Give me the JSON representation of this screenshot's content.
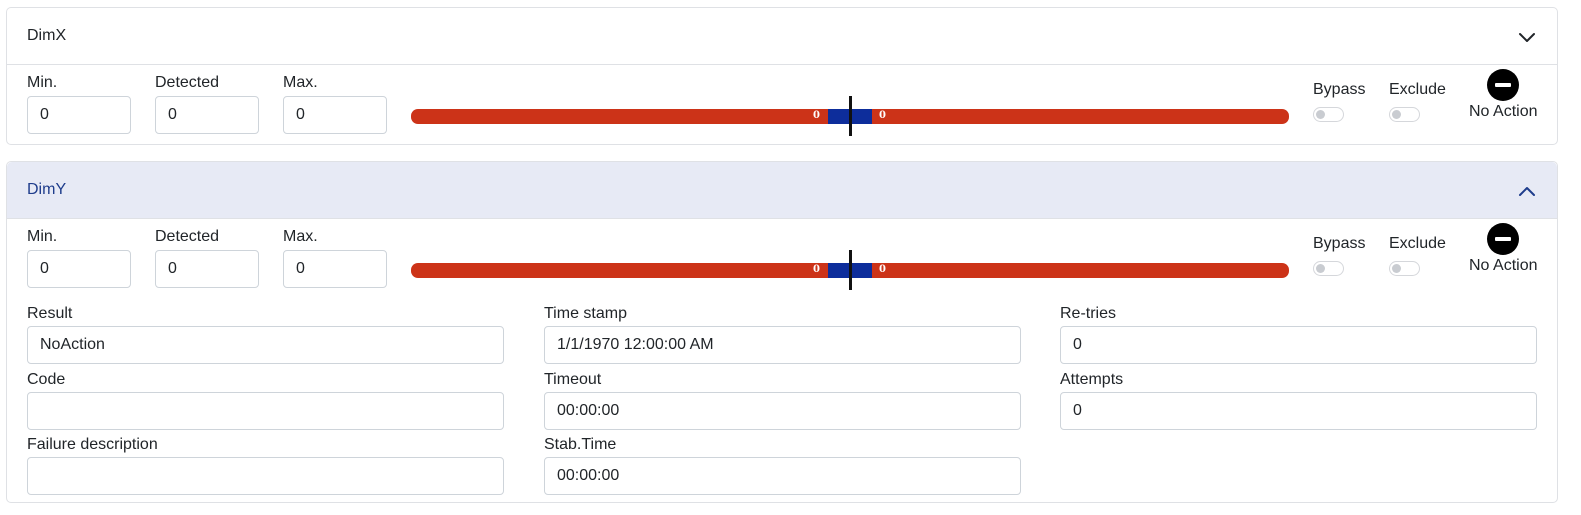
{
  "panels": {
    "x": {
      "title": "DimX",
      "min_label": "Min.",
      "min_value": "0",
      "detected_label": "Detected",
      "detected_value": "0",
      "max_label": "Max.",
      "max_value": "0",
      "bar_left": "0",
      "bar_right": "0",
      "bypass_label": "Bypass",
      "exclude_label": "Exclude",
      "action_label": "No Action",
      "expanded": false
    },
    "y": {
      "title": "DimY",
      "min_label": "Min.",
      "min_value": "0",
      "detected_label": "Detected",
      "detected_value": "0",
      "max_label": "Max.",
      "max_value": "0",
      "bar_left": "0",
      "bar_right": "0",
      "bypass_label": "Bypass",
      "exclude_label": "Exclude",
      "action_label": "No Action",
      "expanded": true,
      "details": {
        "result_label": "Result",
        "result_value": "NoAction",
        "code_label": "Code",
        "code_value": "",
        "failure_label": "Failure description",
        "failure_value": "",
        "timestamp_label": "Time stamp",
        "timestamp_value": "1/1/1970 12:00:00 AM",
        "timeout_label": "Timeout",
        "timeout_value": "00:00:00",
        "stab_label": "Stab.Time",
        "stab_value": "00:00:00",
        "retries_label": "Re-tries",
        "retries_value": "0",
        "attempts_label": "Attempts",
        "attempts_value": "0"
      }
    }
  },
  "colors": {
    "bar_out_of_range": "#cc3318",
    "bar_in_range": "#0d2d9b",
    "expanded_header_bg": "#e7eaf5",
    "expanded_title": "#1f3d8c"
  },
  "icons": {
    "collapsed": "chevron-down-icon",
    "expanded": "chevron-up-icon",
    "action": "minus-circle-icon"
  }
}
